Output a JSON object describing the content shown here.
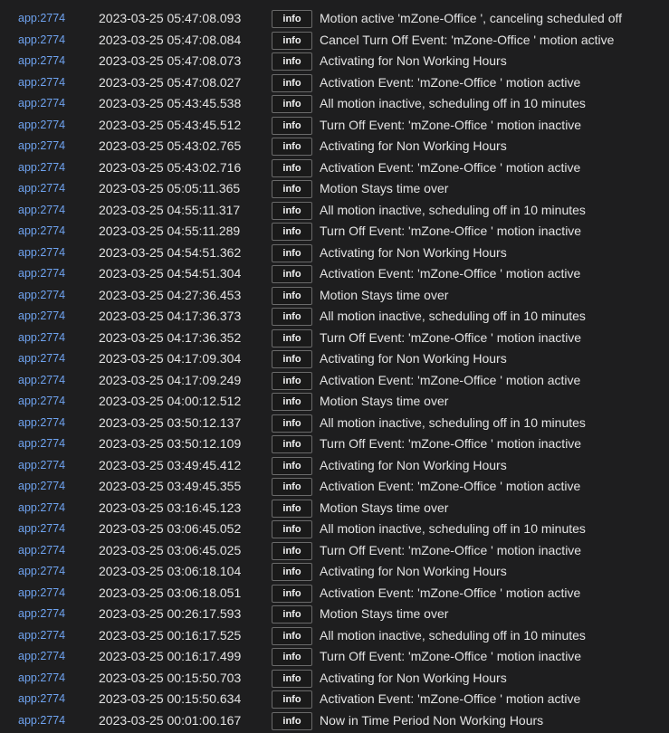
{
  "log": {
    "entries": [
      {
        "source": "app:2774",
        "timestamp": "2023-03-25 05:47:08.093",
        "level": "info",
        "message": "Motion active 'mZone-Office ', canceling scheduled off"
      },
      {
        "source": "app:2774",
        "timestamp": "2023-03-25 05:47:08.084",
        "level": "info",
        "message": "Cancel Turn Off Event: 'mZone-Office ' motion active"
      },
      {
        "source": "app:2774",
        "timestamp": "2023-03-25 05:47:08.073",
        "level": "info",
        "message": "Activating for Non Working Hours"
      },
      {
        "source": "app:2774",
        "timestamp": "2023-03-25 05:47:08.027",
        "level": "info",
        "message": "Activation Event: 'mZone-Office ' motion active"
      },
      {
        "source": "app:2774",
        "timestamp": "2023-03-25 05:43:45.538",
        "level": "info",
        "message": "All motion inactive, scheduling off in 10 minutes"
      },
      {
        "source": "app:2774",
        "timestamp": "2023-03-25 05:43:45.512",
        "level": "info",
        "message": "Turn Off Event: 'mZone-Office ' motion inactive"
      },
      {
        "source": "app:2774",
        "timestamp": "2023-03-25 05:43:02.765",
        "level": "info",
        "message": "Activating for Non Working Hours"
      },
      {
        "source": "app:2774",
        "timestamp": "2023-03-25 05:43:02.716",
        "level": "info",
        "message": "Activation Event: 'mZone-Office ' motion active"
      },
      {
        "source": "app:2774",
        "timestamp": "2023-03-25 05:05:11.365",
        "level": "info",
        "message": "Motion Stays time over"
      },
      {
        "source": "app:2774",
        "timestamp": "2023-03-25 04:55:11.317",
        "level": "info",
        "message": "All motion inactive, scheduling off in 10 minutes"
      },
      {
        "source": "app:2774",
        "timestamp": "2023-03-25 04:55:11.289",
        "level": "info",
        "message": "Turn Off Event: 'mZone-Office ' motion inactive"
      },
      {
        "source": "app:2774",
        "timestamp": "2023-03-25 04:54:51.362",
        "level": "info",
        "message": "Activating for Non Working Hours"
      },
      {
        "source": "app:2774",
        "timestamp": "2023-03-25 04:54:51.304",
        "level": "info",
        "message": "Activation Event: 'mZone-Office ' motion active"
      },
      {
        "source": "app:2774",
        "timestamp": "2023-03-25 04:27:36.453",
        "level": "info",
        "message": "Motion Stays time over"
      },
      {
        "source": "app:2774",
        "timestamp": "2023-03-25 04:17:36.373",
        "level": "info",
        "message": "All motion inactive, scheduling off in 10 minutes"
      },
      {
        "source": "app:2774",
        "timestamp": "2023-03-25 04:17:36.352",
        "level": "info",
        "message": "Turn Off Event: 'mZone-Office ' motion inactive"
      },
      {
        "source": "app:2774",
        "timestamp": "2023-03-25 04:17:09.304",
        "level": "info",
        "message": "Activating for Non Working Hours"
      },
      {
        "source": "app:2774",
        "timestamp": "2023-03-25 04:17:09.249",
        "level": "info",
        "message": "Activation Event: 'mZone-Office ' motion active"
      },
      {
        "source": "app:2774",
        "timestamp": "2023-03-25 04:00:12.512",
        "level": "info",
        "message": "Motion Stays time over"
      },
      {
        "source": "app:2774",
        "timestamp": "2023-03-25 03:50:12.137",
        "level": "info",
        "message": "All motion inactive, scheduling off in 10 minutes"
      },
      {
        "source": "app:2774",
        "timestamp": "2023-03-25 03:50:12.109",
        "level": "info",
        "message": "Turn Off Event: 'mZone-Office ' motion inactive"
      },
      {
        "source": "app:2774",
        "timestamp": "2023-03-25 03:49:45.412",
        "level": "info",
        "message": "Activating for Non Working Hours"
      },
      {
        "source": "app:2774",
        "timestamp": "2023-03-25 03:49:45.355",
        "level": "info",
        "message": "Activation Event: 'mZone-Office ' motion active"
      },
      {
        "source": "app:2774",
        "timestamp": "2023-03-25 03:16:45.123",
        "level": "info",
        "message": "Motion Stays time over"
      },
      {
        "source": "app:2774",
        "timestamp": "2023-03-25 03:06:45.052",
        "level": "info",
        "message": "All motion inactive, scheduling off in 10 minutes"
      },
      {
        "source": "app:2774",
        "timestamp": "2023-03-25 03:06:45.025",
        "level": "info",
        "message": "Turn Off Event: 'mZone-Office ' motion inactive"
      },
      {
        "source": "app:2774",
        "timestamp": "2023-03-25 03:06:18.104",
        "level": "info",
        "message": "Activating for Non Working Hours"
      },
      {
        "source": "app:2774",
        "timestamp": "2023-03-25 03:06:18.051",
        "level": "info",
        "message": "Activation Event: 'mZone-Office ' motion active"
      },
      {
        "source": "app:2774",
        "timestamp": "2023-03-25 00:26:17.593",
        "level": "info",
        "message": "Motion Stays time over"
      },
      {
        "source": "app:2774",
        "timestamp": "2023-03-25 00:16:17.525",
        "level": "info",
        "message": "All motion inactive, scheduling off in 10 minutes"
      },
      {
        "source": "app:2774",
        "timestamp": "2023-03-25 00:16:17.499",
        "level": "info",
        "message": "Turn Off Event: 'mZone-Office ' motion inactive"
      },
      {
        "source": "app:2774",
        "timestamp": "2023-03-25 00:15:50.703",
        "level": "info",
        "message": "Activating for Non Working Hours"
      },
      {
        "source": "app:2774",
        "timestamp": "2023-03-25 00:15:50.634",
        "level": "info",
        "message": "Activation Event: 'mZone-Office ' motion active"
      },
      {
        "source": "app:2774",
        "timestamp": "2023-03-25 00:01:00.167",
        "level": "info",
        "message": "Now in Time Period Non Working Hours"
      }
    ]
  },
  "colors": {
    "background": "#1e1e1f",
    "source_link": "#6fa3f0",
    "text": "#e3e3e3",
    "badge_border": "#6a6a6a"
  }
}
